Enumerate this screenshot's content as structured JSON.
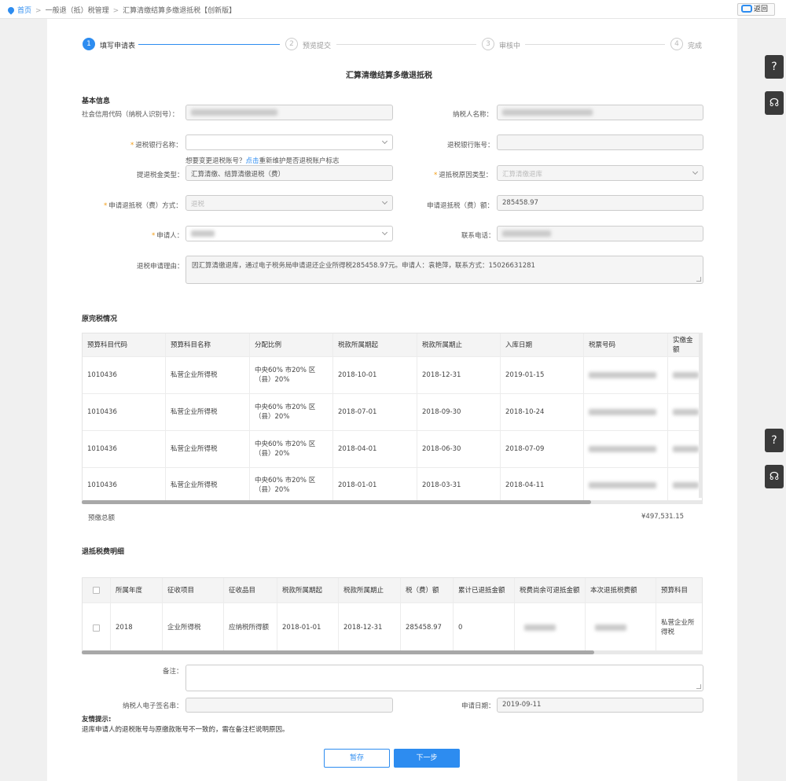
{
  "breadcrumb": {
    "items": [
      "首页",
      "一般退（抵）税管理",
      "汇算清缴结算多缴退抵税【创新版】"
    ]
  },
  "back_label": "返回",
  "steps": [
    {
      "num": "1",
      "label": "填写申请表"
    },
    {
      "num": "2",
      "label": "预览提交"
    },
    {
      "num": "3",
      "label": "审核中"
    },
    {
      "num": "4",
      "label": "完成"
    }
  ],
  "form_title": "汇算清缴结算多缴退抵税",
  "basic": {
    "section_title": "基本信息",
    "credit_code_label": "社会信用代码（纳税人识别号）：",
    "taxpayer_name_label": "纳税人名称：",
    "bank_name_label": "退税银行名称：",
    "bank_account_label": "退税银行账号：",
    "hint_prefix": "想要变更退税账号？",
    "hint_link": "点击",
    "hint_suffix": "重新维护是否退税账户标志",
    "fund_type_label": "提退税金类型：",
    "fund_type_value": "汇算清缴、结算清缴退税（费）",
    "reason_type_label": "退抵税原因类型：",
    "reason_type_value": "汇算清缴退库",
    "method_label": "申请退抵税（费）方式：",
    "method_value": "退税",
    "amount_label": "申请退抵税（费）额：",
    "amount_value": "285458.97",
    "applicant_label": "申请人：",
    "phone_label": "联系电话：",
    "reason_label": "退税申请理由：",
    "reason_value": "因汇算清缴退库，通过电子税务局申请退还企业所得税285458.97元。申请人：袁艳萍，联系方式：15026631281"
  },
  "original": {
    "section_title": "原完税情况",
    "headers": [
      "预算科目代码",
      "预算科目名称",
      "分配比例",
      "税款所属期起",
      "税款所属期止",
      "入库日期",
      "税票号码",
      "实缴金额"
    ],
    "rows": [
      {
        "code": "1010436",
        "name": "私营企业所得税",
        "ratio": "中央60% 市20% 区（县）20%",
        "start": "2018-10-01",
        "end": "2018-12-31",
        "date": "2019-01-15"
      },
      {
        "code": "1010436",
        "name": "私营企业所得税",
        "ratio": "中央60% 市20% 区（县）20%",
        "start": "2018-07-01",
        "end": "2018-09-30",
        "date": "2018-10-24"
      },
      {
        "code": "1010436",
        "name": "私营企业所得税",
        "ratio": "中央60% 市20% 区（县）20%",
        "start": "2018-04-01",
        "end": "2018-06-30",
        "date": "2018-07-09"
      },
      {
        "code": "1010436",
        "name": "私营企业所得税",
        "ratio": "中央60% 市20% 区（县）20%",
        "start": "2018-01-01",
        "end": "2018-03-31",
        "date": "2018-04-11"
      }
    ],
    "total_label": "预缴总额",
    "total_value": "¥497,531.15"
  },
  "refund": {
    "section_title": "退抵税费明细",
    "headers": [
      "所属年度",
      "征收项目",
      "征收品目",
      "税款所属期起",
      "税款所属期止",
      "税（费）额",
      "累计已退抵金额",
      "税费尚余可退抵金额",
      "本次退抵税费额",
      "预算科目"
    ],
    "row": {
      "year": "2018",
      "item": "企业所得税",
      "sub": "应纳税所得额",
      "start": "2018-01-01",
      "end": "2018-12-31",
      "tax": "285458.97",
      "refunded": "0",
      "budget": "私营企业所得税"
    }
  },
  "remark_label": "备注：",
  "signature_label": "纳税人电子签名串：",
  "apply_date_label": "申请日期：",
  "apply_date_value": "2019-09-11",
  "tips_title": "友情提示:",
  "tips_text": "退库申请人的退税账号与原缴款账号不一致的，需在备注栏说明原因。",
  "buttons": {
    "save": "暂存",
    "next": "下一步"
  },
  "accent_color": "#2d8cf0"
}
